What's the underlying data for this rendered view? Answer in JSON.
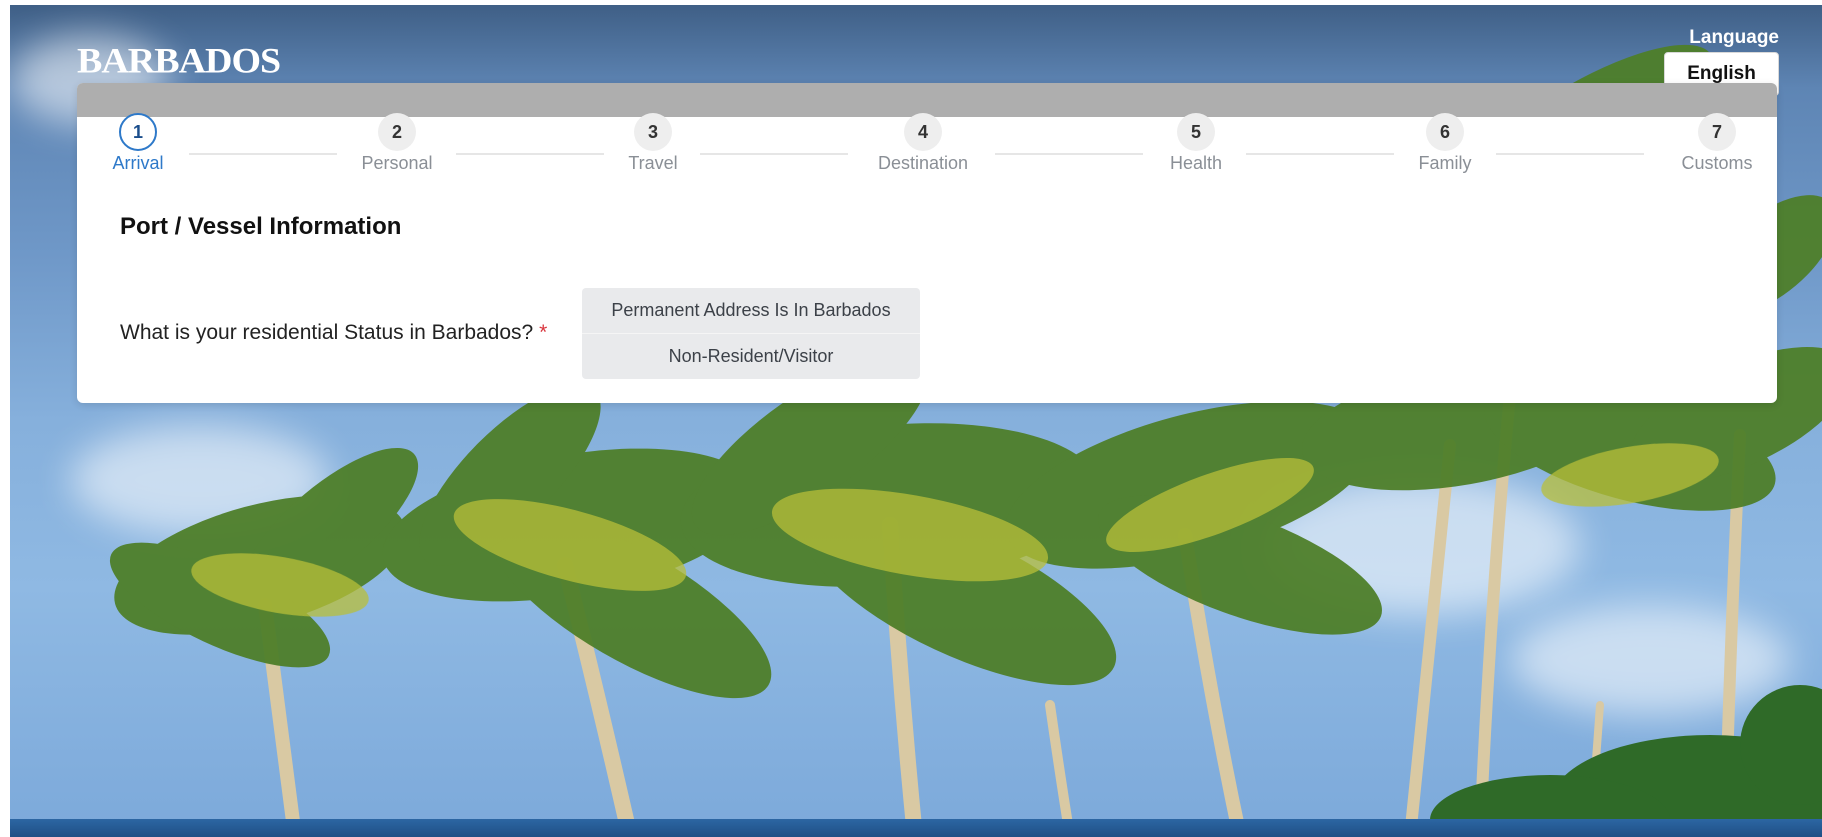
{
  "header": {
    "logo_text": "BARBADOS",
    "language_label": "Language",
    "language_value": "English"
  },
  "stepper": {
    "steps": [
      {
        "number": "1",
        "label": "Arrival",
        "active": true
      },
      {
        "number": "2",
        "label": "Personal",
        "active": false
      },
      {
        "number": "3",
        "label": "Travel",
        "active": false
      },
      {
        "number": "4",
        "label": "Destination",
        "active": false
      },
      {
        "number": "5",
        "label": "Health",
        "active": false
      },
      {
        "number": "6",
        "label": "Family",
        "active": false
      },
      {
        "number": "7",
        "label": "Customs",
        "active": false
      }
    ]
  },
  "form": {
    "section_title": "Port / Vessel Information",
    "question": "What is your residential Status in Barbados?",
    "required_marker": "*",
    "options": [
      "Permanent Address Is In Barbados",
      "Non-Resident/Visitor"
    ]
  },
  "colors": {
    "accent": "#2e79c9",
    "required": "#d9363e"
  },
  "icons": {
    "background": "palm-trees-background"
  }
}
